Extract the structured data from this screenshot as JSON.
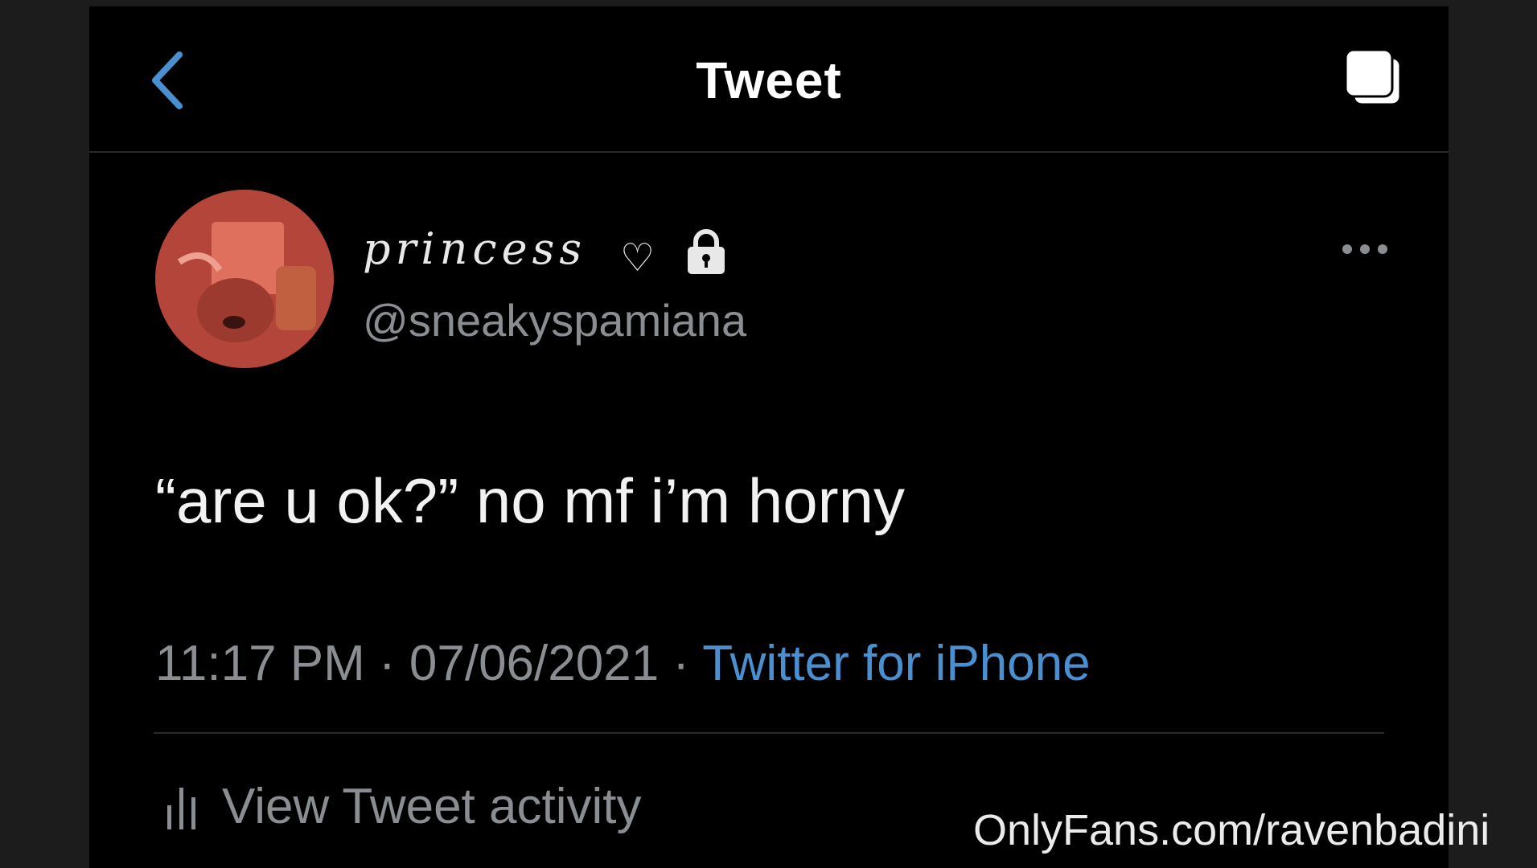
{
  "nav": {
    "title": "Tweet"
  },
  "tweet": {
    "display_name": "princess",
    "name_decoration": "♡",
    "handle": "@sneakyspamiana",
    "text": "“are u ok?” no mf i’m horny",
    "time": "11:17 PM",
    "date": "07/06/2021",
    "separator": " · ",
    "source": "Twitter for iPhone"
  },
  "activity": {
    "label": "View Tweet activity"
  },
  "watermark": {
    "text": "OnlyFans.com/ravenbadini"
  },
  "colors": {
    "background": "#000000",
    "accent": "#4a8fd0",
    "muted": "#8a8d91",
    "avatar": "#a8392c"
  },
  "icons": [
    "back-chevron-icon",
    "copy-icon",
    "lock-icon",
    "more-icon",
    "bar-chart-icon"
  ]
}
